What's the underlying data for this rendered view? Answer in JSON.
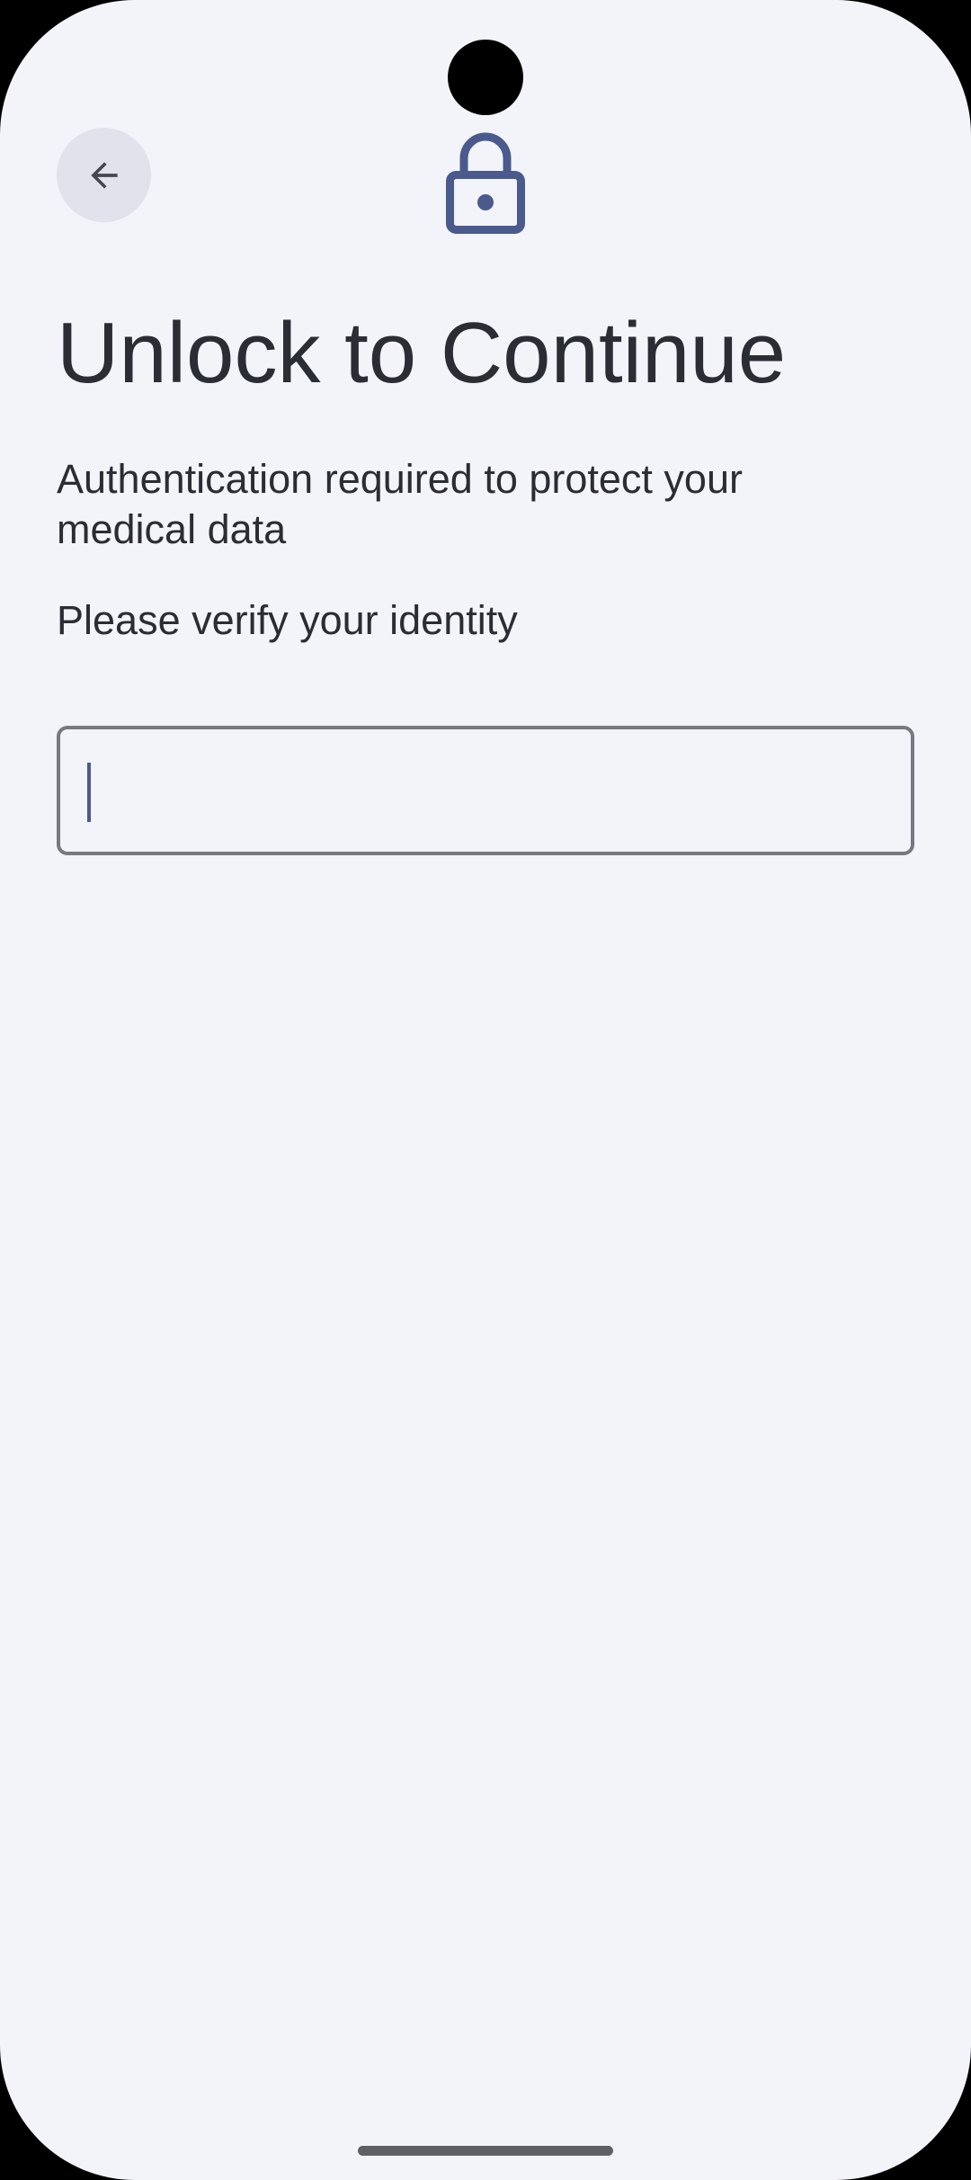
{
  "header": {
    "back_icon": "arrow-back-icon",
    "lock_icon": "lock-icon"
  },
  "content": {
    "title": "Unlock to Continue",
    "description": "Authentication required to protect your medical data",
    "prompt": "Please verify your identity"
  },
  "pin_field": {
    "value": "",
    "placeholder": ""
  },
  "colors": {
    "background": "#f3f4f9",
    "accent": "#4a5a8c",
    "text": "#2b2d34",
    "outline": "#777880",
    "back_button_bg": "#e1e2ec"
  }
}
